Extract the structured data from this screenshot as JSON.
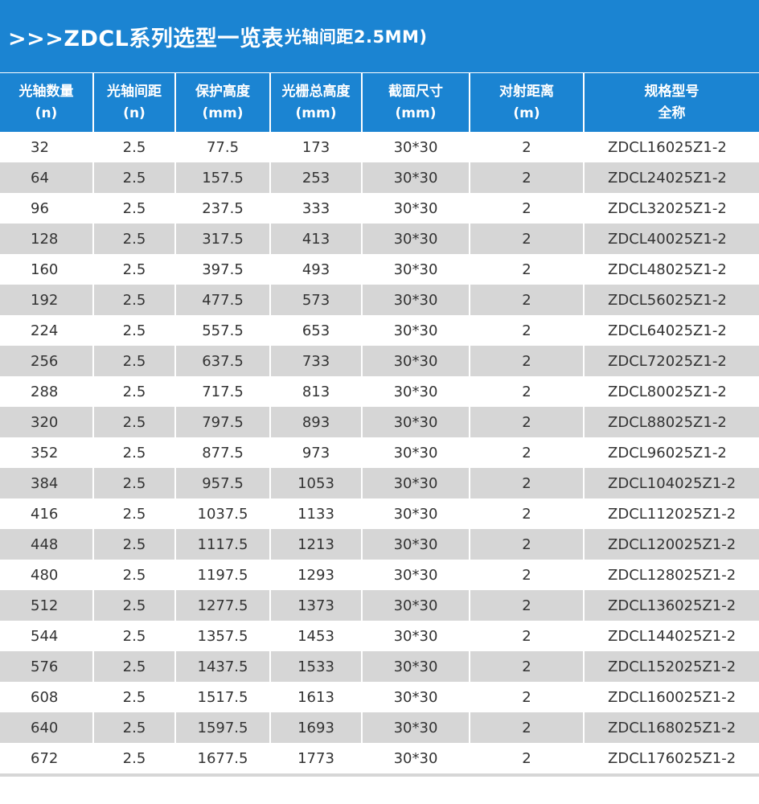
{
  "header": {
    "title_main": ">>>ZDCL系列选型一览表",
    "title_sub": "光轴间距2.5MM)"
  },
  "table": {
    "columns": [
      {
        "line1": "光轴数量",
        "line2": "(n)"
      },
      {
        "line1": "光轴间距",
        "line2": "(n)"
      },
      {
        "line1": "保护高度",
        "line2": "(mm)"
      },
      {
        "line1": "光栅总高度",
        "line2": "(mm)"
      },
      {
        "line1": "截面尺寸",
        "line2": "(mm)"
      },
      {
        "line1": "对射距离",
        "line2": "(m)"
      },
      {
        "line1": "规格型号",
        "line2": "全称"
      }
    ],
    "rows": [
      [
        "32",
        "2.5",
        "77.5",
        "173",
        "30*30",
        "2",
        "ZDCL16025Z1-2"
      ],
      [
        "64",
        "2.5",
        "157.5",
        "253",
        "30*30",
        "2",
        "ZDCL24025Z1-2"
      ],
      [
        "96",
        "2.5",
        "237.5",
        "333",
        "30*30",
        "2",
        "ZDCL32025Z1-2"
      ],
      [
        "128",
        "2.5",
        "317.5",
        "413",
        "30*30",
        "2",
        "ZDCL40025Z1-2"
      ],
      [
        "160",
        "2.5",
        "397.5",
        "493",
        "30*30",
        "2",
        "ZDCL48025Z1-2"
      ],
      [
        "192",
        "2.5",
        "477.5",
        "573",
        "30*30",
        "2",
        "ZDCL56025Z1-2"
      ],
      [
        "224",
        "2.5",
        "557.5",
        "653",
        "30*30",
        "2",
        "ZDCL64025Z1-2"
      ],
      [
        "256",
        "2.5",
        "637.5",
        "733",
        "30*30",
        "2",
        "ZDCL72025Z1-2"
      ],
      [
        "288",
        "2.5",
        "717.5",
        "813",
        "30*30",
        "2",
        "ZDCL80025Z1-2"
      ],
      [
        "320",
        "2.5",
        "797.5",
        "893",
        "30*30",
        "2",
        "ZDCL88025Z1-2"
      ],
      [
        "352",
        "2.5",
        "877.5",
        "973",
        "30*30",
        "2",
        "ZDCL96025Z1-2"
      ],
      [
        "384",
        "2.5",
        "957.5",
        "1053",
        "30*30",
        "2",
        "ZDCL104025Z1-2"
      ],
      [
        "416",
        "2.5",
        "1037.5",
        "1133",
        "30*30",
        "2",
        "ZDCL112025Z1-2"
      ],
      [
        "448",
        "2.5",
        "1117.5",
        "1213",
        "30*30",
        "2",
        "ZDCL120025Z1-2"
      ],
      [
        "480",
        "2.5",
        "1197.5",
        "1293",
        "30*30",
        "2",
        "ZDCL128025Z1-2"
      ],
      [
        "512",
        "2.5",
        "1277.5",
        "1373",
        "30*30",
        "2",
        "ZDCL136025Z1-2"
      ],
      [
        "544",
        "2.5",
        "1357.5",
        "1453",
        "30*30",
        "2",
        "ZDCL144025Z1-2"
      ],
      [
        "576",
        "2.5",
        "1437.5",
        "1533",
        "30*30",
        "2",
        "ZDCL152025Z1-2"
      ],
      [
        "608",
        "2.5",
        "1517.5",
        "1613",
        "30*30",
        "2",
        "ZDCL160025Z1-2"
      ],
      [
        "640",
        "2.5",
        "1597.5",
        "1693",
        "30*30",
        "2",
        "ZDCL168025Z1-2"
      ],
      [
        "672",
        "2.5",
        "1677.5",
        "1773",
        "30*30",
        "2",
        "ZDCL176025Z1-2"
      ]
    ]
  },
  "colors": {
    "header_blue": "#1b84d2",
    "row_stripe": "#d6d6d6",
    "text": "#333333"
  }
}
